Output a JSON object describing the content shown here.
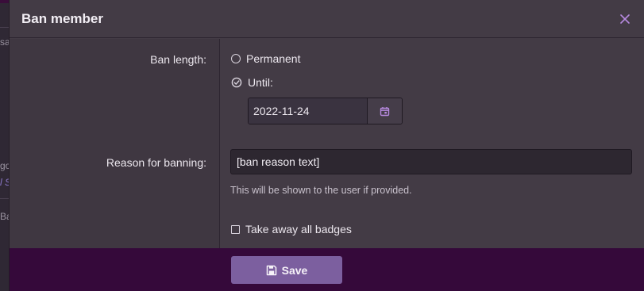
{
  "dialog": {
    "title": "Ban member",
    "close_icon": "close-icon"
  },
  "ban_length": {
    "label": "Ban length:",
    "option_permanent": "Permanent",
    "option_until": "Until:",
    "selected": "until",
    "date_value": "2022-11-24",
    "date_icon": "calendar-icon"
  },
  "reason": {
    "label": "Reason for banning:",
    "value": "[ban reason text]",
    "hint": "This will be shown to the user if provided."
  },
  "badges": {
    "label": "Take away all badges",
    "checked": false
  },
  "footer": {
    "save_label": "Save",
    "save_icon": "save-icon"
  },
  "background": {
    "fragments": [
      "sa",
      "go",
      "l S",
      "Ba"
    ]
  },
  "colors": {
    "accent": "#b78ae0",
    "save_button": "#7c5f9f",
    "footer_bg": "#35093a"
  }
}
